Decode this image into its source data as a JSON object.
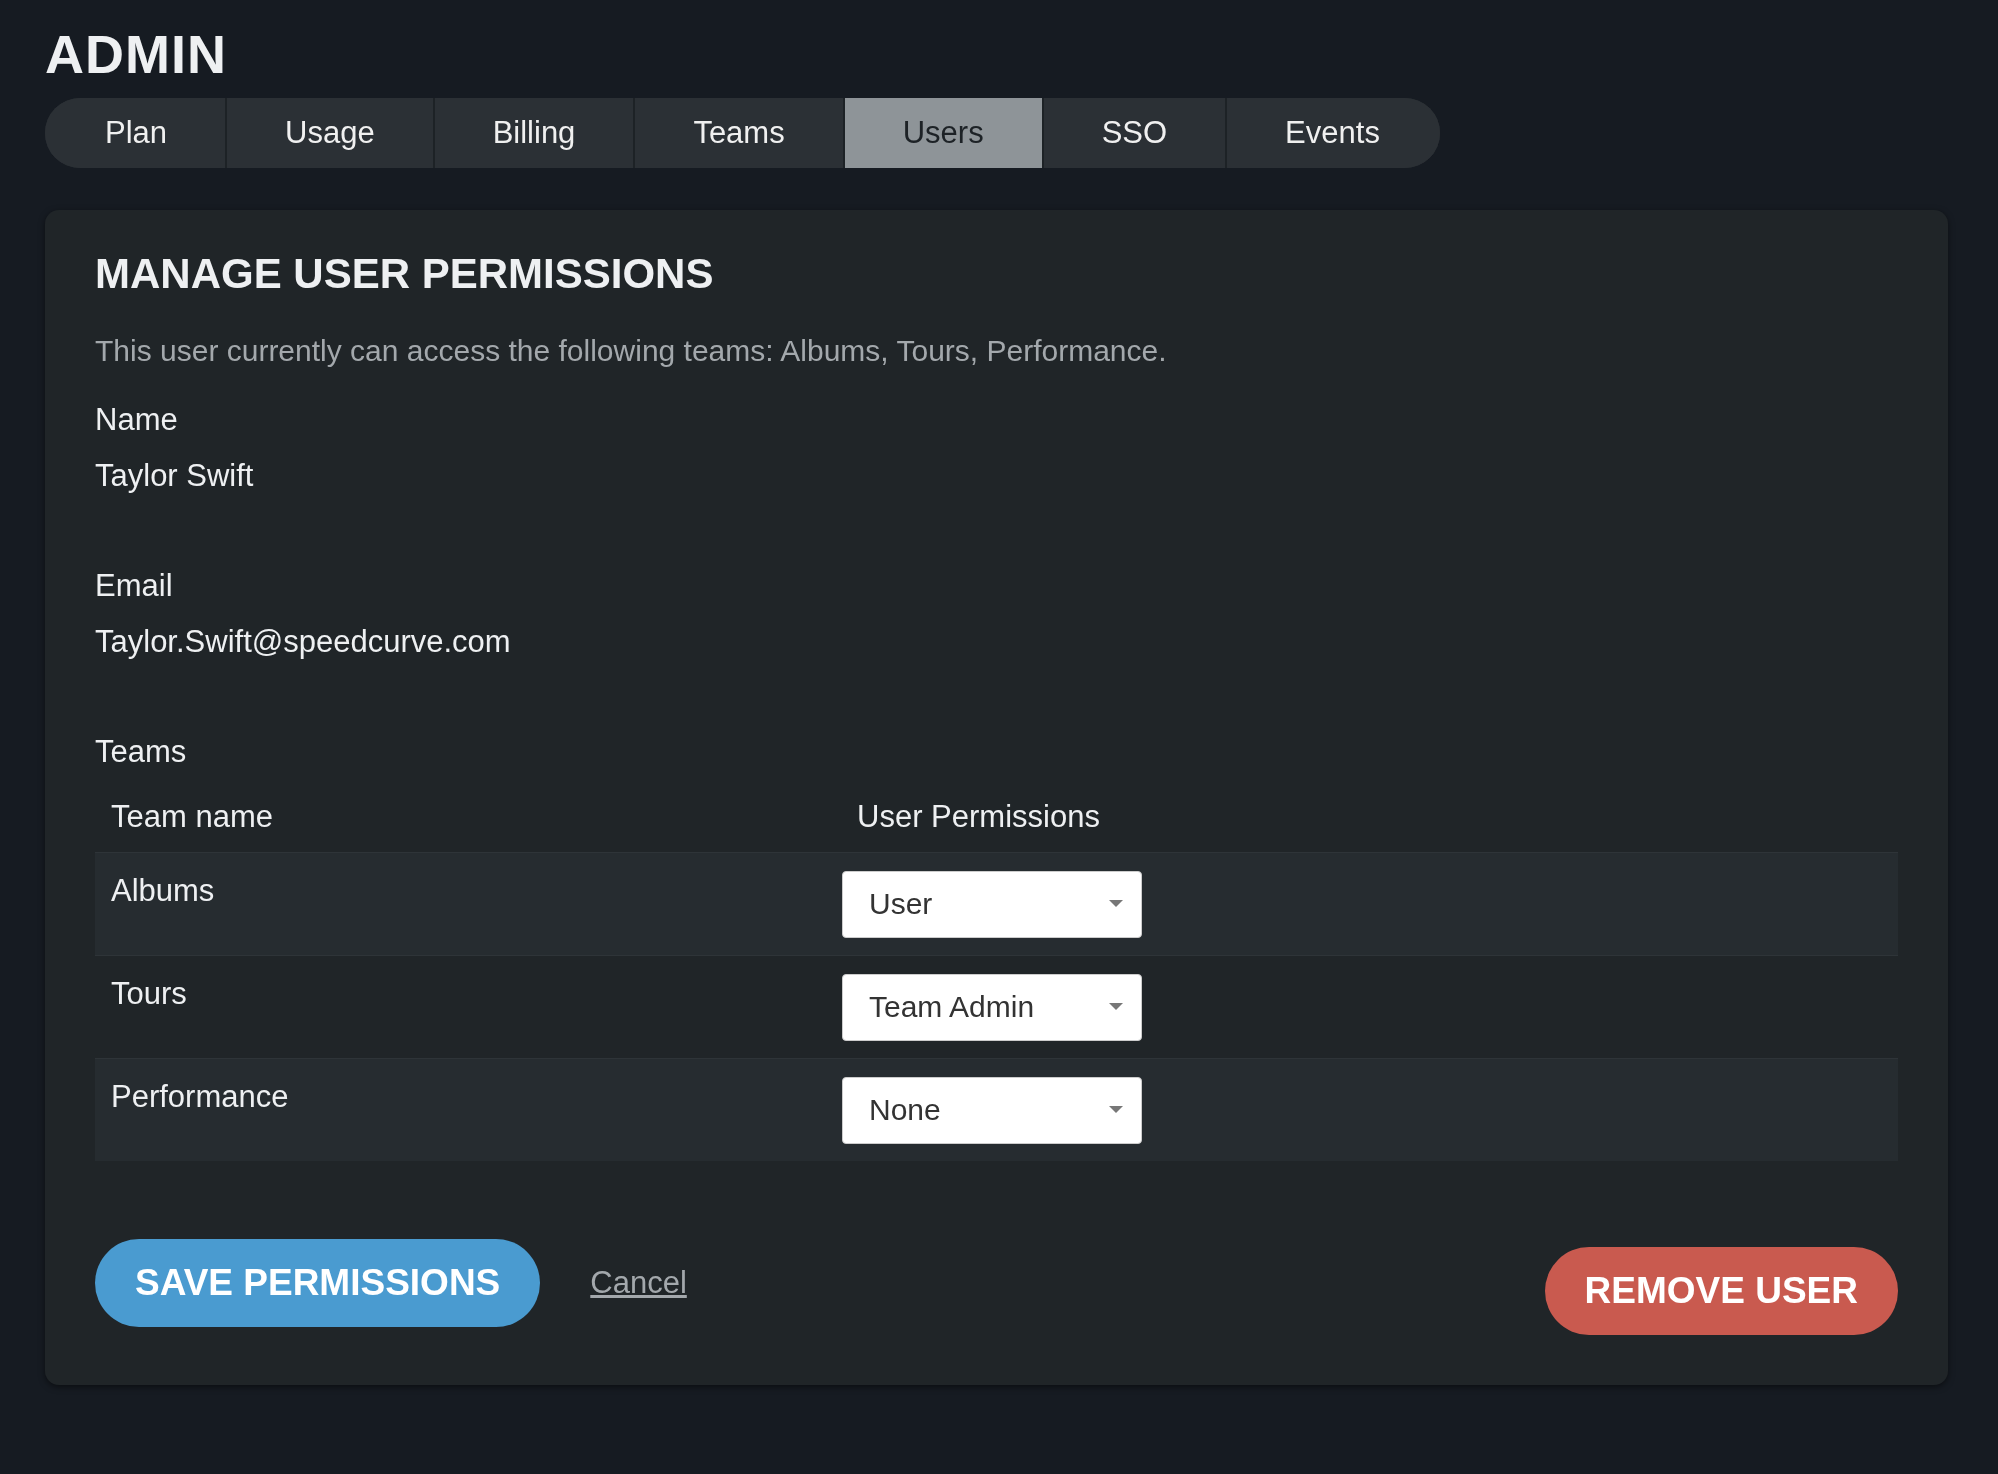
{
  "page_title": "ADMIN",
  "tabs": [
    {
      "label": "Plan",
      "selected": false
    },
    {
      "label": "Usage",
      "selected": false
    },
    {
      "label": "Billing",
      "selected": false
    },
    {
      "label": "Teams",
      "selected": false
    },
    {
      "label": "Users",
      "selected": true
    },
    {
      "label": "SSO",
      "selected": false
    },
    {
      "label": "Events",
      "selected": false
    }
  ],
  "panel": {
    "heading": "MANAGE USER PERMISSIONS",
    "description": "This user currently can access the following teams: Albums, Tours, Performance.",
    "fields": [
      {
        "label": "Name",
        "value": "Taylor Swift"
      },
      {
        "label": "Email",
        "value": "Taylor.Swift@speedcurve.com"
      }
    ],
    "teams_label": "Teams",
    "table": {
      "columns": [
        "Team name",
        "User Permissions"
      ],
      "rows": [
        {
          "team": "Albums",
          "permission": "User"
        },
        {
          "team": "Tours",
          "permission": "Team Admin"
        },
        {
          "team": "Performance",
          "permission": "None"
        }
      ]
    },
    "save_button": "SAVE PERMISSIONS",
    "cancel_link": "Cancel",
    "remove_button": "REMOVE USER"
  }
}
